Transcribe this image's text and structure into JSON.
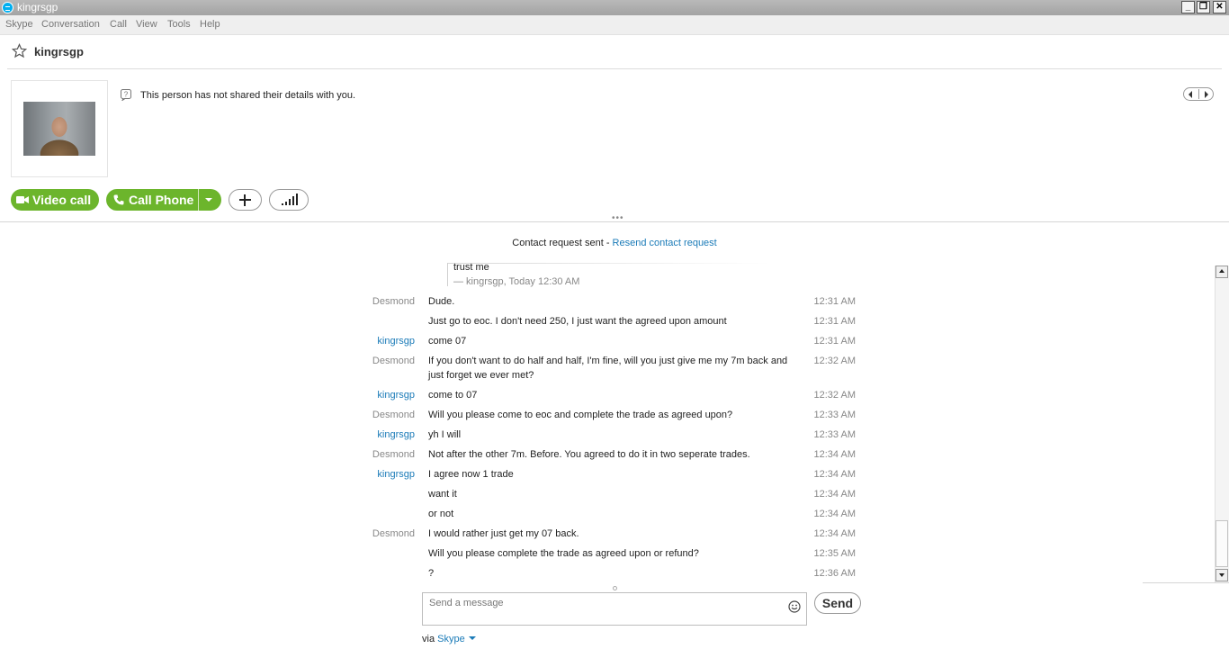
{
  "window": {
    "title": "kingrsgp"
  },
  "menu": [
    "Skype",
    "Conversation",
    "Call",
    "View",
    "Tools",
    "Help"
  ],
  "header": {
    "contact_name": "kingrsgp"
  },
  "profile": {
    "info_text": "This person has not shared their details with you."
  },
  "actions": {
    "video_call": "Video call",
    "call_phone": "Call Phone"
  },
  "notice": {
    "text": "Contact request sent - ",
    "link": "Resend contact request"
  },
  "quote": {
    "text": "trust me",
    "meta": "— kingrsgp, Today 12:30 AM"
  },
  "messages": [
    {
      "sender": "Desmond",
      "text": "Dude.",
      "time": "12:31 AM",
      "me": false
    },
    {
      "sender": "",
      "text": "Just go to eoc. I don't need 250, I just want the agreed upon amount",
      "time": "12:31 AM",
      "me": false
    },
    {
      "sender": "kingrsgp",
      "text": "come 07",
      "time": "12:31 AM",
      "me": true
    },
    {
      "sender": "Desmond",
      "text": "If you don't want to do half and half, I'm fine, will you just give me my 7m back and just forget we ever met?",
      "time": "12:32 AM",
      "me": false
    },
    {
      "sender": "kingrsgp",
      "text": "come to 07",
      "time": "12:32 AM",
      "me": true
    },
    {
      "sender": "Desmond",
      "text": "Will you please come to eoc and complete the trade as agreed upon?",
      "time": "12:33 AM",
      "me": false
    },
    {
      "sender": "kingrsgp",
      "text": "yh I will",
      "time": "12:33 AM",
      "me": true
    },
    {
      "sender": "Desmond",
      "text": "Not after the other 7m. Before. You agreed to do it in two seperate trades.",
      "time": "12:34 AM",
      "me": false
    },
    {
      "sender": "kingrsgp",
      "text": "I agree now 1 trade",
      "time": "12:34 AM",
      "me": true
    },
    {
      "sender": "",
      "text": "want it",
      "time": "12:34 AM",
      "me": true
    },
    {
      "sender": "",
      "text": "or not",
      "time": "12:34 AM",
      "me": true
    },
    {
      "sender": "Desmond",
      "text": "I would rather just get my 07 back.",
      "time": "12:34 AM",
      "me": false
    },
    {
      "sender": "",
      "text": "Will you please complete the trade as agreed upon or refund?",
      "time": "12:35 AM",
      "me": false
    },
    {
      "sender": "",
      "text": "?",
      "time": "12:36 AM",
      "me": false
    }
  ],
  "composer": {
    "placeholder": "Send a message",
    "send_label": "Send",
    "via_text": "via ",
    "via_link": "Skype"
  },
  "colors": {
    "accent_green": "#6cb52c",
    "link_blue": "#1b7bb8",
    "titlebar_gray": "#a3a3a3"
  }
}
